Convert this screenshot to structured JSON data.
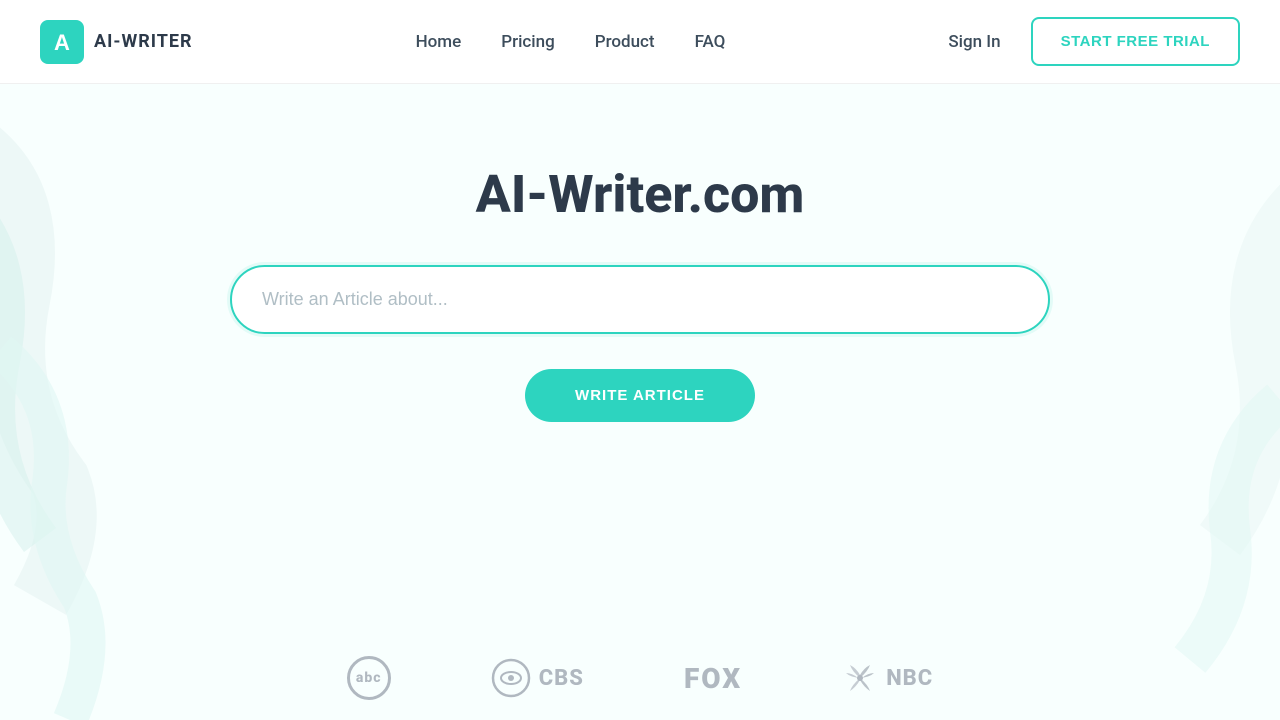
{
  "brand": {
    "logo_text": "AI-WRITER",
    "logo_icon_letter": "A"
  },
  "navbar": {
    "home_label": "Home",
    "pricing_label": "Pricing",
    "product_label": "Product",
    "faq_label": "FAQ",
    "sign_in_label": "Sign In",
    "start_trial_label": "START FREE TRIAL"
  },
  "hero": {
    "title": "AI-Writer.com",
    "input_placeholder": "Write an Article about...",
    "write_button_label": "WRITE ARTICLE"
  },
  "media_logos": [
    {
      "id": "abc",
      "label": "abc"
    },
    {
      "id": "cbs",
      "label": "CBS"
    },
    {
      "id": "fox",
      "label": "FOX"
    },
    {
      "id": "nbc",
      "label": "NBC"
    }
  ],
  "colors": {
    "accent": "#2dd4bf",
    "text_dark": "#2d3a4a",
    "text_mid": "#3d4d5c",
    "logo_gray": "#b0b8c0"
  }
}
